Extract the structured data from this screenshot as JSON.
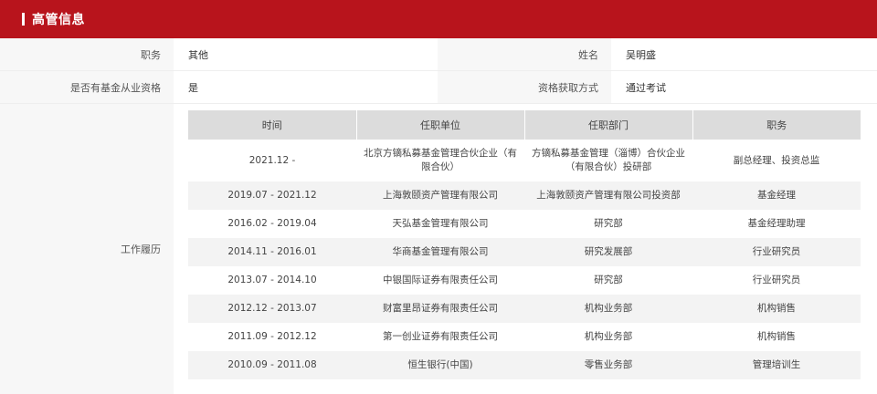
{
  "header": {
    "title": "高管信息"
  },
  "info": {
    "position_label": "职务",
    "position_value": "其他",
    "name_label": "姓名",
    "name_value": "吴明盛",
    "qualified_label": "是否有基金从业资格",
    "qualified_value": "是",
    "qual_method_label": "资格获取方式",
    "qual_method_value": "通过考试",
    "history_label": "工作履历"
  },
  "history": {
    "columns": [
      "时间",
      "任职单位",
      "任职部门",
      "职务"
    ],
    "rows": [
      [
        "2021.12 -",
        "北京方镝私募基金管理合伙企业（有限合伙）",
        "方镝私募基金管理（淄博）合伙企业（有限合伙）投研部",
        "副总经理、投资总监"
      ],
      [
        "2019.07 - 2021.12",
        "上海敦颐资产管理有限公司",
        "上海敦颐资产管理有限公司投资部",
        "基金经理"
      ],
      [
        "2016.02 - 2019.04",
        "天弘基金管理有限公司",
        "研究部",
        "基金经理助理"
      ],
      [
        "2014.11 - 2016.01",
        "华商基金管理有限公司",
        "研究发展部",
        "行业研究员"
      ],
      [
        "2013.07 - 2014.10",
        "中银国际证券有限责任公司",
        "研究部",
        "行业研究员"
      ],
      [
        "2012.12 - 2013.07",
        "财富里昂证券有限责任公司",
        "机构业务部",
        "机构销售"
      ],
      [
        "2011.09 - 2012.12",
        "第一创业证券有限责任公司",
        "机构业务部",
        "机构销售"
      ],
      [
        "2010.09 - 2011.08",
        "恒生银行(中国)",
        "零售业务部",
        "管理培训生"
      ]
    ]
  }
}
